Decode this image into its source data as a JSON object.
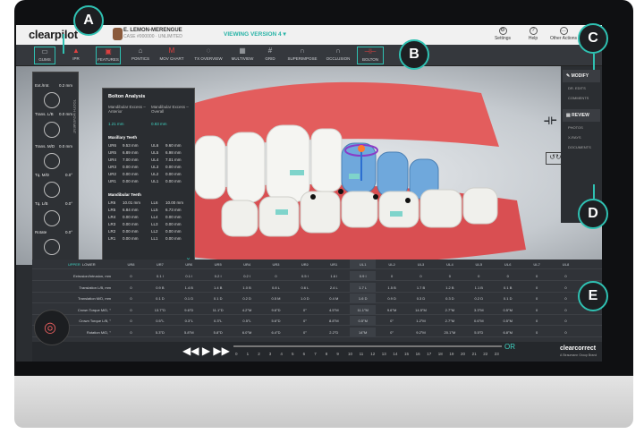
{
  "header": {
    "logo": "clearpilot",
    "patient_name": "E. LEMON-MERENGUE",
    "patient_sub": "CASE #000000 · UNLIMITED",
    "version_label": "VIEWING VERSION 4",
    "right_items": [
      "Settings",
      "Help",
      "Other Actions"
    ]
  },
  "toolbar": {
    "items": [
      {
        "label": "GUMS",
        "icon": "gum-icon"
      },
      {
        "label": "IPR",
        "icon": "ipr-icon"
      },
      {
        "label": "FEATURES",
        "icon": "features-icon"
      },
      {
        "label": "PONTICS",
        "icon": "pontics-icon"
      },
      {
        "label": "MOV CHART",
        "icon": "chart-icon"
      },
      {
        "label": "TX OVERVIEW",
        "icon": "overview-icon"
      },
      {
        "label": "MULTIVIEW",
        "icon": "multiview-icon"
      },
      {
        "label": "GRID",
        "icon": "grid-icon"
      },
      {
        "label": "SUPERIMPOSE",
        "icon": "superimpose-icon"
      },
      {
        "label": "OCCLUSION",
        "icon": "occlusion-icon"
      },
      {
        "label": "BOLTON",
        "icon": "bolton-icon"
      }
    ]
  },
  "left_panel": {
    "title": "TOOTH MOVEMENT",
    "rows": [
      {
        "label": "Ext./Intr.",
        "value": "0.2 mm"
      },
      {
        "label": "Trans. L/B",
        "value": "0.0 mm"
      },
      {
        "label": "Trans. M/D",
        "value": "0.0 mm"
      },
      {
        "label": "Tq. M/D",
        "value": "0.0°"
      },
      {
        "label": "Tq. L/B",
        "value": "0.0°"
      },
      {
        "label": "Rotate",
        "value": "0.0°"
      }
    ]
  },
  "bolton": {
    "title": "Bolton Analysis",
    "col1": "Mandibular Excess – Anterior",
    "col2": "Mandibular Excess – Overall",
    "val1": "1.21 mm",
    "val2": "0.83 mm",
    "max_title": "Maxillary Teeth",
    "max_rows": [
      [
        "UR6",
        "9.53 mm",
        "UL6",
        "9.60 mm"
      ],
      [
        "UR5",
        "6.89 mm",
        "UL5",
        "6.98 mm"
      ],
      [
        "UR4",
        "7.00 mm",
        "UL4",
        "7.01 mm"
      ],
      [
        "UR3",
        "0.00 mm",
        "UL3",
        "0.00 mm"
      ],
      [
        "UR2",
        "0.00 mm",
        "UL2",
        "0.00 mm"
      ],
      [
        "UR1",
        "0.00 mm",
        "UL1",
        "0.00 mm"
      ]
    ],
    "mand_title": "Mandibular Teeth",
    "mand_rows": [
      [
        "LR6",
        "10.01 mm",
        "LL6",
        "10.00 mm"
      ],
      [
        "LR5",
        "6.84 mm",
        "LL5",
        "6.73 mm"
      ],
      [
        "LR4",
        "0.00 mm",
        "LL4",
        "0.00 mm"
      ],
      [
        "LR3",
        "0.00 mm",
        "LL3",
        "0.00 mm"
      ],
      [
        "LR2",
        "0.00 mm",
        "LL2",
        "0.00 mm"
      ],
      [
        "LR1",
        "0.00 mm",
        "LL1",
        "0.00 mm"
      ]
    ]
  },
  "right_panel": {
    "modify": "MODIFY",
    "modify_items": [
      "DR. EDITS",
      "COMMENTS"
    ],
    "review": "REVIEW",
    "review_items": [
      "PHOTOS",
      "X-RAYS",
      "DOCUMENTS"
    ]
  },
  "table": {
    "arch_tabs": [
      "UPPER",
      "LOWER"
    ],
    "columns": [
      "UR8",
      "UR7",
      "UR6",
      "UR5",
      "UR4",
      "UR3",
      "UR2",
      "UR1",
      "UL1",
      "UL2",
      "UL3",
      "UL4",
      "UL5",
      "UL6",
      "UL7",
      "UL8"
    ],
    "rows": [
      {
        "label": "Extrusion/Intrusion, mm",
        "values": [
          "0",
          "0.1 I",
          "0.1 I",
          "0.2 I",
          "0.2 I",
          "0",
          "0.5 I",
          "1.6 I",
          "0.9 I",
          "0",
          "0",
          "0",
          "0",
          "0",
          "0",
          "0"
        ]
      },
      {
        "label": "Translation L/B, mm",
        "values": [
          "0",
          "0.9 B",
          "1.4 B",
          "1.4 B",
          "1.0 B",
          "0.8 L",
          "0.6 L",
          "2.4 L",
          "1.7 L",
          "1.5 B",
          "1.7 B",
          "1.2 B",
          "1.1 B",
          "0.1 B",
          "0",
          "0"
        ]
      },
      {
        "label": "Translation M/D, mm",
        "values": [
          "0",
          "0.1 D",
          "0.1 D",
          "0.1 D",
          "0.2 D",
          "0.5 M",
          "1.0 D",
          "0.4 M",
          "1.6 D",
          "0.9 D",
          "0.3 D",
          "0.3 D",
          "0.2 D",
          "0.1 D",
          "0",
          "0"
        ]
      },
      {
        "label": "Crown Torque M/D, °",
        "values": [
          "0",
          "13.7°D",
          "9.6°D",
          "11.1°D",
          "4.2°M",
          "9.6°D",
          "0°",
          "4.5°M",
          "11.1°M",
          "9.6°M",
          "14.5°M",
          "2.7°M",
          "3.3°M",
          "0.5°M",
          "0",
          "0"
        ]
      },
      {
        "label": "Crown Torque L/B, °",
        "values": [
          "0",
          "0.5°L",
          "0.3°L",
          "0.3°L",
          "0.5°L",
          "5.6°D",
          "0°",
          "8.8°M",
          "0.5°M",
          "0°",
          "1.2°M",
          "2.7°M",
          "0.6°M",
          "0.5°M",
          "0",
          "0"
        ]
      },
      {
        "label": "Rotation M/D, °",
        "values": [
          "0",
          "5.3°D",
          "5.8°M",
          "5.8°D",
          "6.0°M",
          "6.4°D",
          "0°",
          "2.2°D",
          "14°M",
          "0°",
          "9.2°M",
          "20.1°M",
          "5.5°D",
          "6.8°M",
          "0",
          "0"
        ]
      }
    ]
  },
  "timeline": {
    "steps": [
      "0",
      "1",
      "2",
      "3",
      "4",
      "5",
      "6",
      "7",
      "8",
      "9",
      "10",
      "11",
      "12",
      "13",
      "14",
      "15",
      "16",
      "17",
      "18",
      "19",
      "20",
      "21",
      "22",
      "23"
    ],
    "end_label": "OR",
    "brand": "clearcorrect",
    "brand_sub": "A Straumann Group Brand"
  },
  "callouts": [
    "A",
    "B",
    "C",
    "D",
    "E"
  ],
  "colors": {
    "accent": "#2fc1b2",
    "gum": "#e35d5d",
    "tooth": "#f5f5f2",
    "moved_tooth": "#6fa8dc"
  }
}
